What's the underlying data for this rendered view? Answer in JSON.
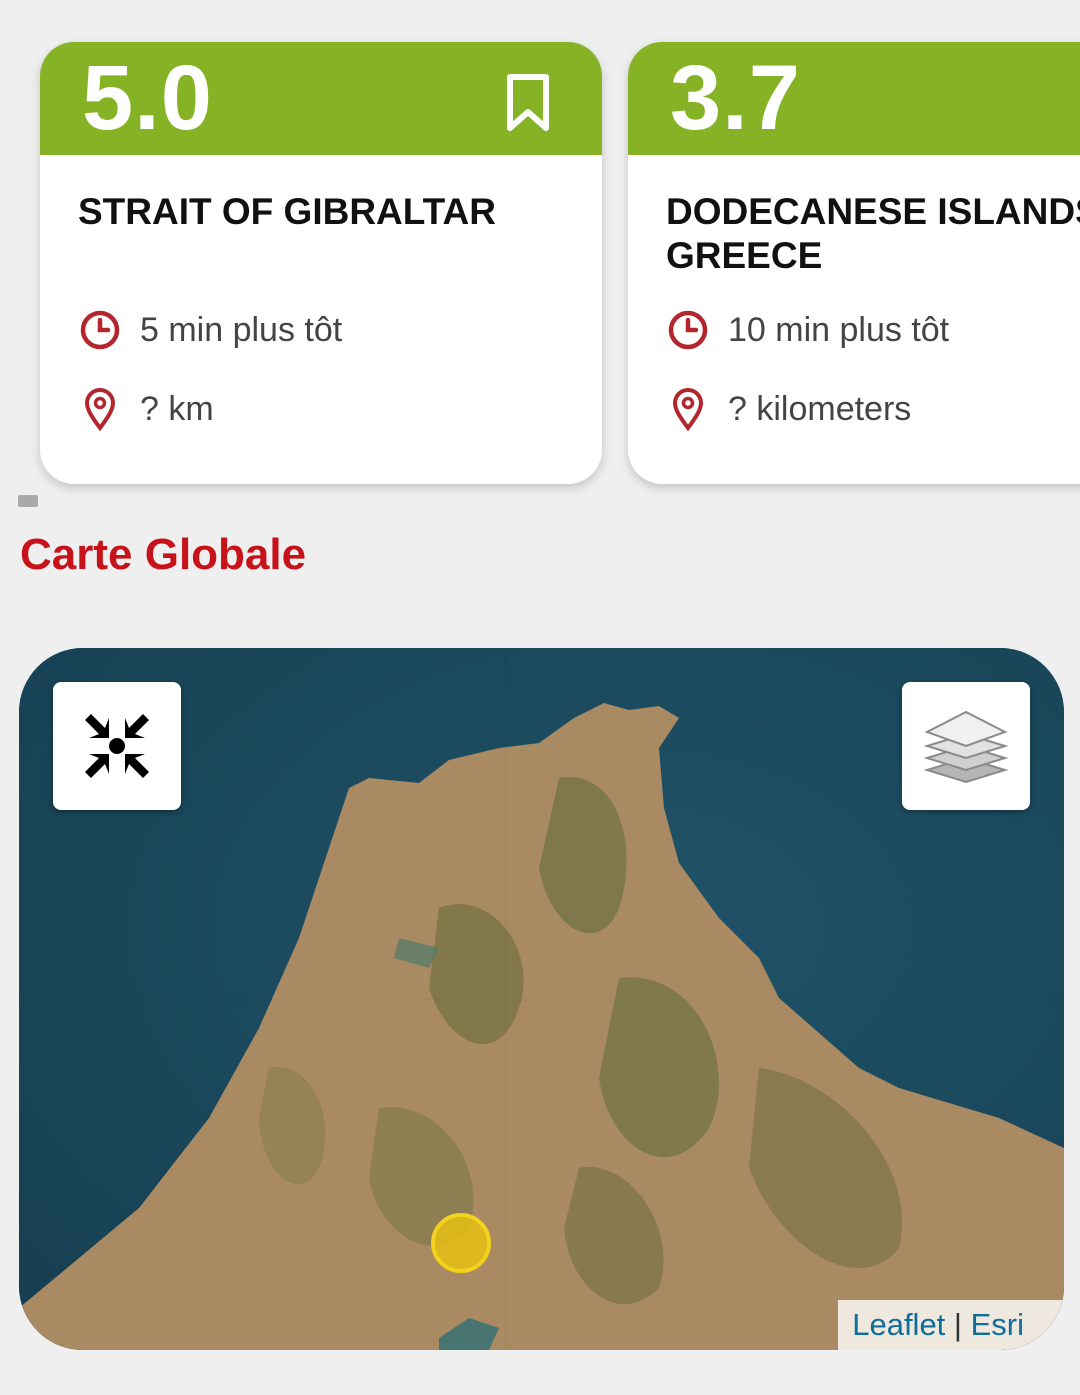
{
  "cards": [
    {
      "magnitude": "5.0",
      "place": "STRAIT OF GIBRALTAR",
      "time": "5 min plus tôt",
      "distance": "? km",
      "bookmark_icon": "bookmark-outline-icon"
    },
    {
      "magnitude": "3.7",
      "place": "DODECANESE ISLANDS,\nGREECE",
      "time": "10 min plus tôt",
      "distance": "? kilometers"
    }
  ],
  "section": {
    "title": "Carte Globale"
  },
  "map": {
    "fit_button_icon": "collapse-arrows-icon",
    "layers_button_icon": "layers-icon",
    "attribution_leaflet": "Leaflet",
    "attribution_separator": "|",
    "attribution_esri": "Esri"
  },
  "colors": {
    "card_header": "#86b225",
    "section_title": "#c8121a",
    "marker": "#e8c014",
    "icon_red": "#b3262e"
  }
}
